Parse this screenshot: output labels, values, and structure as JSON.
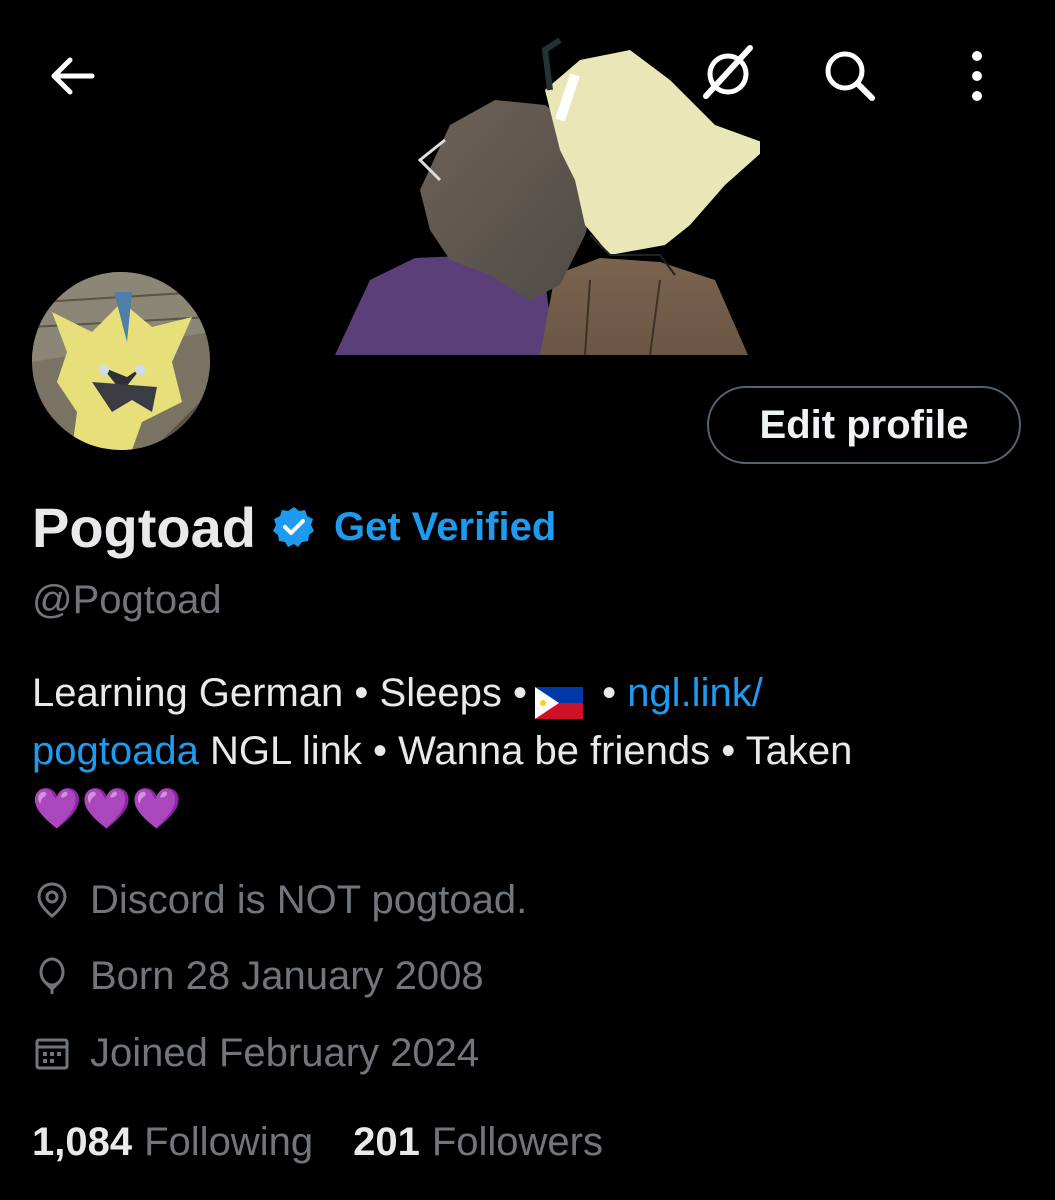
{
  "topbar": {
    "back_icon": "arrow-left-icon",
    "grok_icon": "slashed-circle-icon",
    "search_icon": "search-icon",
    "more_icon": "vertical-dots-icon"
  },
  "profile": {
    "display_name": "Pogtoad",
    "verified_badge_icon": "verified-badge-icon",
    "get_verified_label": "Get Verified",
    "handle": "@Pogtoad",
    "edit_profile_label": "Edit profile"
  },
  "bio": {
    "line1_text": "Learning German • Sleeps •",
    "flag_icon": "philippines-flag-icon",
    "line1_sep": " • ",
    "link_part1": "ngl.link/",
    "link_part2": "pogtoada",
    "line2_text": " NGL link • Wanna be friends • Taken",
    "hearts": "💜💜💜"
  },
  "meta": {
    "location": "Discord is NOT pogtoad.",
    "birthday": "Born 28 January 2008",
    "joined": "Joined February 2024"
  },
  "stats": {
    "following_count": "1,084",
    "following_label": "Following",
    "followers_count": "201",
    "followers_label": "Followers"
  },
  "colors": {
    "background": "#000000",
    "text_primary": "#e7e9ea",
    "text_secondary": "#71767b",
    "accent_blue": "#1d9bf0",
    "border": "#536471"
  }
}
